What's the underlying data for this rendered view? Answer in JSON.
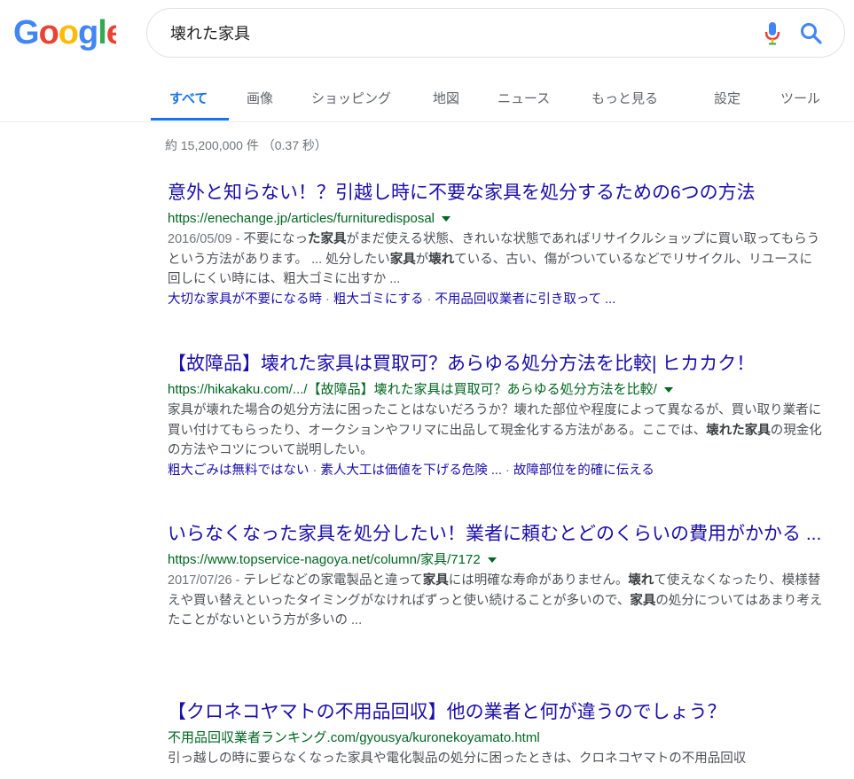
{
  "search": {
    "query": "壊れた家具"
  },
  "logo": {
    "text": "Google"
  },
  "tabs": [
    {
      "label": "すべて"
    },
    {
      "label": "画像"
    },
    {
      "label": "ショッピング"
    },
    {
      "label": "地図"
    },
    {
      "label": "ニュース"
    },
    {
      "label": "もっと見る"
    },
    {
      "label": "設定"
    },
    {
      "label": "ツール"
    }
  ],
  "stats": "約 15,200,000 件 （0.37 秒）",
  "results": [
    {
      "title": "意外と知らない！？引越し時に不要な家具を処分するための6つの方法",
      "url": "https://enechange.jp/articles/furnituredisposal",
      "date": "2016/05/09 - ",
      "snippet": [
        "不要になっ",
        "た家具",
        "がまだ使える状態、きれいな状態であればリサイクルショップに買い取ってもらうという方法があります。 ... 処分したい",
        "家具",
        "が",
        "壊れ",
        "ている、古い、傷がついているなどでリサイクル、リユースに回しにくい時には、粗大ゴミに出すか ..."
      ],
      "sitelinks": [
        "大切な家具が不要になる時",
        "粗大ゴミにする",
        "不用品回収業者に引き取って ..."
      ]
    },
    {
      "title": "【故障品】壊れた家具は買取可？あらゆる処分方法を比較| ヒカカク！",
      "url": "https://hikakaku.com/.../【故障品】壊れた家具は買取可？あらゆる処分方法を比較/",
      "date": "",
      "snippet": [
        "家具が壊れた場合の処分方法に困ったことはないだろうか？壊れた部位や程度によって異なるが、買い取り業者に買い付けてもらったり、オークションやフリマに出品して現金化する方法がある。ここでは、",
        "壊れた家具",
        "の現金化の方法やコツについて説明したい。"
      ],
      "sitelinks": [
        "粗大ごみは無料ではない",
        "素人大工は価値を下げる危険 ...",
        "故障部位を的確に伝える"
      ]
    },
    {
      "title": "いらなくなった家具を処分したい！業者に頼むとどのくらいの費用がかかる ...",
      "url": "https://www.topservice-nagoya.net/column/家具/7172",
      "date": "2017/07/26 - ",
      "snippet": [
        "テレビなどの家電製品と違って",
        "家具",
        "には明確な寿命がありません。",
        "壊れ",
        "て使えなくなったり、模様替えや買い替えといったタイミングがなければずっと使い続けることが多いので、",
        "家具",
        "の処分についてはあまり考えたことがないという方が多いの ..."
      ],
      "sitelinks": []
    },
    {
      "title": "【クロネコヤマトの不用品回収】他の業者と何が違うのでしょう？",
      "url": "不用品回収業者ランキング.com/gyousya/kuronekoyamato.html",
      "date": "",
      "snippet": [
        "引っ越しの時に要らなくなった家具や電化製品の処分に困ったときは、クロネコヤマトの不用品回収"
      ],
      "sitelinks": []
    }
  ]
}
